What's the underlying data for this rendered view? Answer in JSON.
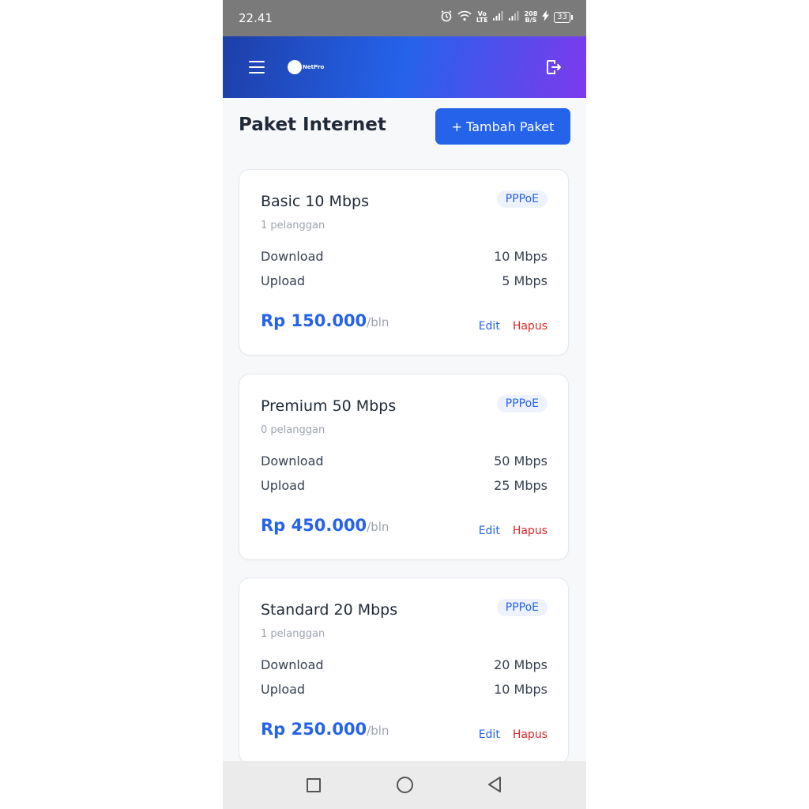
{
  "status_bar": {
    "time": "22.41",
    "network_speed_value": "208",
    "network_speed_unit": "B/S",
    "volte_top": "Vo",
    "volte_bottom": "LTE",
    "battery": "33"
  },
  "app_bar": {
    "logo_text": "NetPro",
    "menu_icon": "hamburger-menu-icon",
    "logout_icon": "logout-icon"
  },
  "page": {
    "title": "Paket Internet",
    "add_button": "+ Tambah Paket"
  },
  "packages": [
    {
      "name": "Basic 10 Mbps",
      "type": "PPPoE",
      "subscribers": "1 pelanggan",
      "download_label": "Download",
      "download": "10 Mbps",
      "upload_label": "Upload",
      "upload": "5 Mbps",
      "price": "Rp 150.000",
      "period": "/bln",
      "edit": "Edit",
      "delete": "Hapus"
    },
    {
      "name": "Premium 50 Mbps",
      "type": "PPPoE",
      "subscribers": "0 pelanggan",
      "download_label": "Download",
      "download": "50 Mbps",
      "upload_label": "Upload",
      "upload": "25 Mbps",
      "price": "Rp 450.000",
      "period": "/bln",
      "edit": "Edit",
      "delete": "Hapus"
    },
    {
      "name": "Standard 20 Mbps",
      "type": "PPPoE",
      "subscribers": "1 pelanggan",
      "download_label": "Download",
      "download": "20 Mbps",
      "upload_label": "Upload",
      "upload": "10 Mbps",
      "price": "Rp 250.000",
      "period": "/bln",
      "edit": "Edit",
      "delete": "Hapus"
    }
  ],
  "colors": {
    "primary": "#2563eb",
    "danger": "#dc2626",
    "gradient_start": "#1e3fa8",
    "gradient_end": "#7c3aed"
  }
}
